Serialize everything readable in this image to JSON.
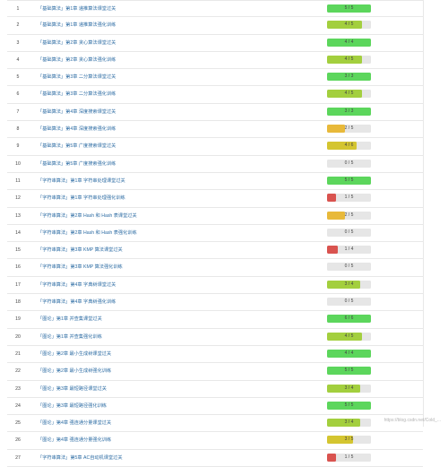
{
  "rows": [
    {
      "num": "1",
      "title": "「基础算法」第1章 递推算法课堂过关",
      "score": "5 / 5",
      "progress": 1.0,
      "color": "#5cd65c"
    },
    {
      "num": "2",
      "title": "「基础算法」第1章 递推算法强化训练",
      "score": "4 / 5",
      "progress": 0.8,
      "color": "#a3cf3e"
    },
    {
      "num": "3",
      "title": "「基础算法」第2章 贪心算法课堂过关",
      "score": "4 / 4",
      "progress": 1.0,
      "color": "#5cd65c"
    },
    {
      "num": "4",
      "title": "「基础算法」第2章 贪心算法强化训练",
      "score": "4 / 5",
      "progress": 0.8,
      "color": "#a3cf3e"
    },
    {
      "num": "5",
      "title": "「基础算法」第3章 二分算法课堂过关",
      "score": "3 / 3",
      "progress": 1.0,
      "color": "#5cd65c"
    },
    {
      "num": "6",
      "title": "「基础算法」第3章 二分算法强化训练",
      "score": "4 / 5",
      "progress": 0.8,
      "color": "#a3cf3e"
    },
    {
      "num": "7",
      "title": "「基础算法」第4章 深度搜索课堂过关",
      "score": "3 / 3",
      "progress": 1.0,
      "color": "#5cd65c"
    },
    {
      "num": "8",
      "title": "「基础算法」第4章 深度搜索强化训练",
      "score": "2 / 5",
      "progress": 0.4,
      "color": "#e8b93a"
    },
    {
      "num": "9",
      "title": "「基础算法」第5章 广度搜索课堂过关",
      "score": "4 / 6",
      "progress": 0.667,
      "color": "#d4c530"
    },
    {
      "num": "10",
      "title": "「基础算法」第5章 广度搜索强化训练",
      "score": "0 / 5",
      "progress": 0.0,
      "color": "#e6e6e6"
    },
    {
      "num": "11",
      "title": "「字符串算法」第1章 字符串处理课堂过关",
      "score": "5 / 5",
      "progress": 1.0,
      "color": "#5cd65c"
    },
    {
      "num": "12",
      "title": "「字符串算法」第1章 字符串处理强化训练",
      "score": "1 / 5",
      "progress": 0.2,
      "color": "#d9534f"
    },
    {
      "num": "13",
      "title": "「字符串算法」第2章 Hash 和 Hash 表课堂过关",
      "score": "2 / 5",
      "progress": 0.4,
      "color": "#e8b93a"
    },
    {
      "num": "14",
      "title": "「字符串算法」第2章 Hash 和 Hash 表强化训练",
      "score": "0 / 5",
      "progress": 0.0,
      "color": "#e6e6e6"
    },
    {
      "num": "15",
      "title": "「字符串算法」第3章 KMP 算法课堂过关",
      "score": "1 / 4",
      "progress": 0.25,
      "color": "#d9534f"
    },
    {
      "num": "16",
      "title": "「字符串算法」第3章 KMP 算法强化训练",
      "score": "0 / 5",
      "progress": 0.0,
      "color": "#e6e6e6"
    },
    {
      "num": "17",
      "title": "「字符串算法」第4章 字典树课堂过关",
      "score": "3 / 4",
      "progress": 0.75,
      "color": "#a3cf3e"
    },
    {
      "num": "18",
      "title": "「字符串算法」第4章 字典树强化训练",
      "score": "0 / 5",
      "progress": 0.0,
      "color": "#e6e6e6"
    },
    {
      "num": "19",
      "title": "「图论」第1章 并查集课堂过关",
      "score": "6 / 6",
      "progress": 1.0,
      "color": "#5cd65c"
    },
    {
      "num": "20",
      "title": "「图论」第1章 并查集强化训练",
      "score": "4 / 5",
      "progress": 0.8,
      "color": "#a3cf3e"
    },
    {
      "num": "21",
      "title": "「图论」第2章 最小生成树课堂过关",
      "score": "4 / 4",
      "progress": 1.0,
      "color": "#5cd65c"
    },
    {
      "num": "22",
      "title": "「图论」第2章 最小生成树强化训练",
      "score": "5 / 5",
      "progress": 1.0,
      "color": "#5cd65c"
    },
    {
      "num": "23",
      "title": "「图论」第3章 最短路径课堂过关",
      "score": "3 / 4",
      "progress": 0.75,
      "color": "#a3cf3e"
    },
    {
      "num": "24",
      "title": "「图论」第3章 最短路径强化训练",
      "score": "5 / 5",
      "progress": 1.0,
      "color": "#5cd65c"
    },
    {
      "num": "25",
      "title": "「图论」第4章 强连通分量课堂过关",
      "score": "3 / 4",
      "progress": 0.75,
      "color": "#a3cf3e"
    },
    {
      "num": "26",
      "title": "「图论」第4章 强连通分量强化训练",
      "score": "3 / 5",
      "progress": 0.6,
      "color": "#d4c530"
    },
    {
      "num": "27",
      "title": "「字符串算法」第5章 AC自动机课堂过关",
      "score": "1 / 5",
      "progress": 0.2,
      "color": "#d9534f"
    }
  ],
  "watermark": "https://blog.csdn.net/Cold_..."
}
